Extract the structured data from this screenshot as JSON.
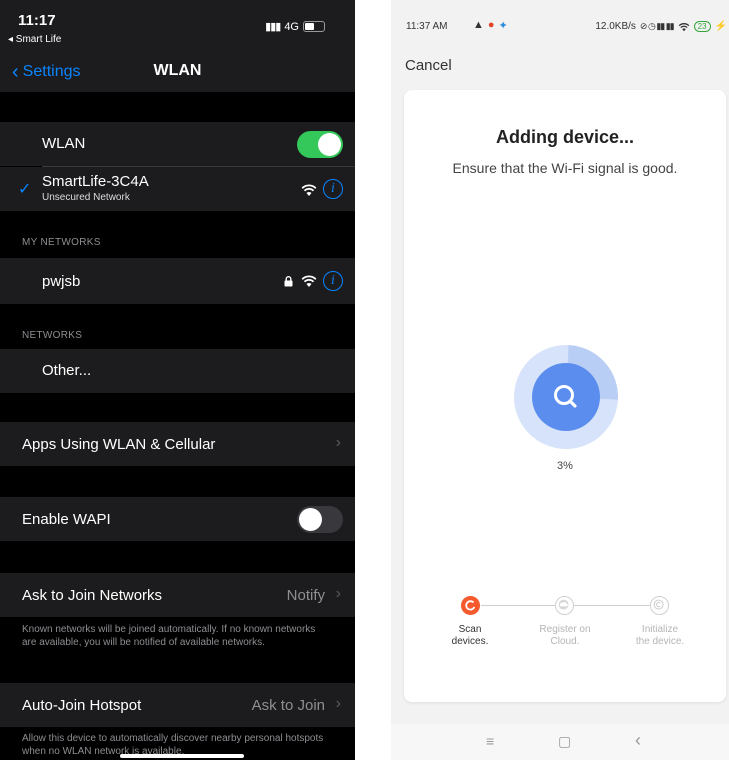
{
  "ios": {
    "status": {
      "time": "11:17",
      "back_app": "◂ Smart Life",
      "network": "4G"
    },
    "nav": {
      "back_label": "Settings",
      "title": "WLAN"
    },
    "wlan_row": {
      "label": "WLAN",
      "on": true
    },
    "connected": {
      "name": "SmartLife-3C4A",
      "subtitle": "Unsecured Network"
    },
    "my_networks_header": "MY NETWORKS",
    "my_networks": [
      {
        "name": "pwjsb",
        "secured": true
      }
    ],
    "networks_header": "NETWORKS",
    "other_label": "Other...",
    "apps_label": "Apps Using WLAN & Cellular",
    "wapi": {
      "label": "Enable WAPI",
      "on": false
    },
    "ask_join": {
      "label": "Ask to Join Networks",
      "value": "Notify"
    },
    "ask_join_note": "Known networks will be joined automatically. If no known networks are available, you will be notified of available networks.",
    "hotspot": {
      "label": "Auto-Join Hotspot",
      "value": "Ask to Join"
    },
    "hotspot_note": "Allow this device to automatically discover nearby personal hotspots when no WLAN network is available."
  },
  "android": {
    "status": {
      "time": "11:37 AM",
      "speed": "12.0KB/s",
      "battery": "23"
    },
    "cancel_label": "Cancel",
    "title": "Adding device...",
    "subtitle": "Ensure that the Wi-Fi signal is good.",
    "progress_text": "3%",
    "progress_value": 0.03,
    "steps": [
      {
        "label_line1": "Scan",
        "label_line2": "devices.",
        "active": true
      },
      {
        "label_line1": "Register on",
        "label_line2": "Cloud.",
        "active": false
      },
      {
        "label_line1": "Initialize",
        "label_line2": "the device.",
        "active": false
      }
    ],
    "nav_buttons": {
      "menu": "≡",
      "home": "▢",
      "back": "‹"
    }
  },
  "colors": {
    "ios_blue": "#0a84ff",
    "ios_green": "#34c759",
    "tuya_orange": "#f5592c",
    "ring_blue": "#5b8def"
  }
}
